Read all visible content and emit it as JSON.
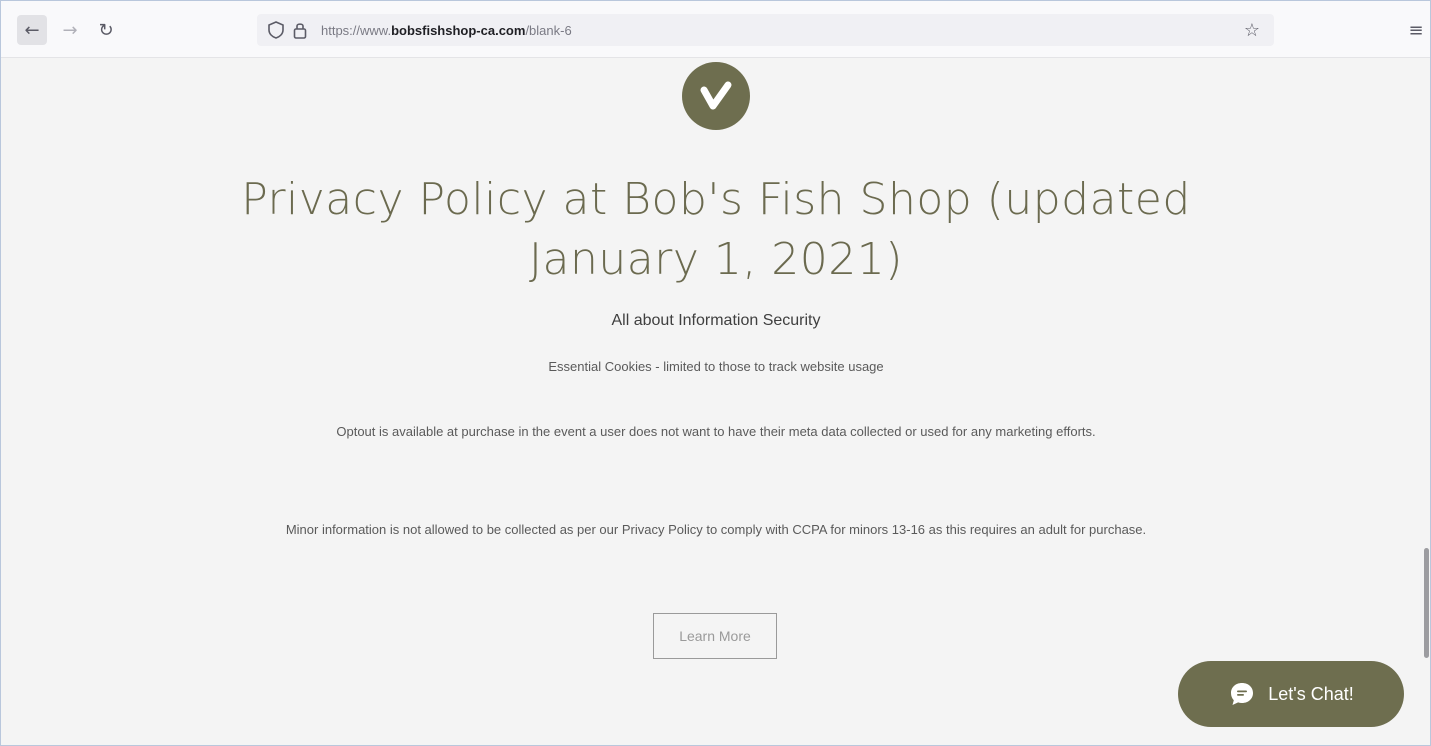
{
  "browser": {
    "url_prefix": "https://www.",
    "url_host": "bobsfishshop-ca.com",
    "url_path": "/blank-6"
  },
  "page": {
    "title_line1": "Privacy Policy at Bob's Fish Shop (updated",
    "title_line2": "January 1, 2021)",
    "subtitle": "All about Information Security",
    "paragraph1": "Essential Cookies - limited to those to track website usage",
    "paragraph2": "Optout is available at purchase in the event a user does not want to have their meta data collected or used for any marketing efforts.",
    "paragraph3": "Minor information is not allowed to be collected as per our Privacy Policy to comply with CCPA for minors 13-16 as this requires an adult for purchase.",
    "learn_more": "Learn More"
  },
  "chat": {
    "label": "Let's Chat!"
  },
  "colors": {
    "brand_olive": "#6e6e4f",
    "title_text": "#6b6a4f",
    "page_background": "#f4f4f4"
  },
  "icons": {
    "back": "arrow-left-icon",
    "forward": "arrow-right-icon",
    "reload": "reload-icon",
    "tracking": "shield-icon",
    "lock": "lock-icon",
    "bookmark": "star-icon",
    "menu": "hamburger-menu-icon",
    "logo": "checkmark-logo",
    "chat": "chat-bubble-icon"
  }
}
